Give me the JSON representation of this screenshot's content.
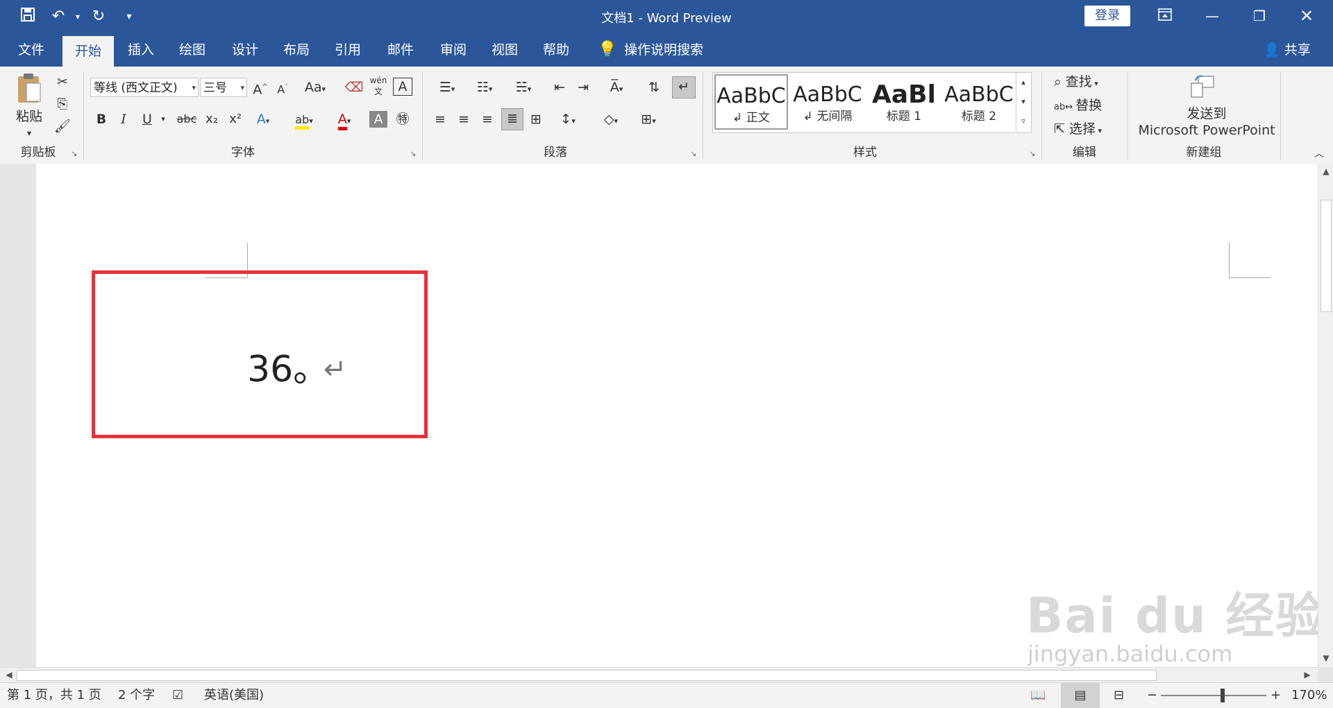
{
  "window": {
    "title": "文档1  -  Word Preview",
    "login_label": "登录",
    "share_label": "共享"
  },
  "quick_access": {
    "save_icon": "save-icon",
    "undo_icon": "undo-icon",
    "redo_icon": "redo-icon"
  },
  "tabs": [
    {
      "label": "文件"
    },
    {
      "label": "开始"
    },
    {
      "label": "插入"
    },
    {
      "label": "绘图"
    },
    {
      "label": "设计"
    },
    {
      "label": "布局"
    },
    {
      "label": "引用"
    },
    {
      "label": "邮件"
    },
    {
      "label": "审阅"
    },
    {
      "label": "视图"
    },
    {
      "label": "帮助"
    },
    {
      "label": "操作说明搜索"
    }
  ],
  "ribbon": {
    "clipboard": {
      "label": "剪贴板",
      "paste_label": "粘贴"
    },
    "font": {
      "label": "字体",
      "font_name": "等线 (西文正文)",
      "font_size": "三号",
      "case_label": "Aa",
      "phonetic_label": "wén 文",
      "bold": "B",
      "italic": "I",
      "underline": "U",
      "strike": "abc",
      "sub": "x₂",
      "sup": "x²"
    },
    "paragraph": {
      "label": "段落"
    },
    "styles": {
      "label": "样式",
      "items": [
        {
          "sample": "AaBbC",
          "name": "↲ 正文"
        },
        {
          "sample": "AaBbC",
          "name": "↲ 无间隔"
        },
        {
          "sample": "AaBl",
          "name": "标题 1"
        },
        {
          "sample": "AaBbC",
          "name": "标题 2"
        }
      ]
    },
    "editing": {
      "label": "编辑",
      "find": "查找",
      "replace": "替换",
      "select": "选择"
    },
    "newgroup": {
      "label": "新建组",
      "send_line1": "发送到",
      "send_line2": "Microsoft PowerPoint"
    }
  },
  "document": {
    "paragraph_text": "36。",
    "paragraph_mark": "↵",
    "highlight_color": "#e8313a"
  },
  "status": {
    "page": "第 1 页，共 1 页",
    "words": "2 个字",
    "language": "英语(美国)",
    "zoom": "170%"
  },
  "watermark": {
    "brand": "Bai du 经验",
    "url": "jingyan.baidu.com"
  },
  "colors": {
    "titlebar": "#2b579a",
    "ribbon": "#f3f3f3"
  }
}
